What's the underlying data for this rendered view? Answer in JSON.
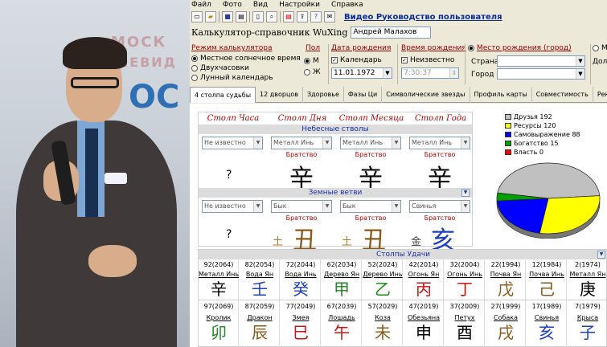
{
  "photo": {
    "banner_line1": "МОСК",
    "banner_line2": "ТЕЛЕВИД",
    "banner_line3": "ОС"
  },
  "menu": [
    "Файл",
    "Фото",
    "Вид",
    "Настройки",
    "Справка"
  ],
  "toolbar": {
    "icons": [
      "new-file-icon",
      "open-folder-icon",
      "save-icon",
      "print-icon",
      "document-icon",
      "search-icon",
      "pdf-icon",
      "export-icon",
      "help-icon",
      "mail-icon"
    ],
    "help_link": "Видео Руководство пользователя"
  },
  "app_title": "Калькулятор-справочник WuXing",
  "person_name": "Андрей Малахов",
  "mode": {
    "title": "Режим калькулятора",
    "options": [
      "Местное солнечное время",
      "Двухчасовки",
      "Лунный календарь"
    ],
    "selected_index": 0
  },
  "gender": {
    "title": "Пол",
    "options": [
      "М",
      "Ж"
    ],
    "selected_index": 0
  },
  "birth_date": {
    "title": "Дата рождения",
    "calendar_label": "Календарь",
    "value": "11.01.1972"
  },
  "birth_time": {
    "title": "Время рождения",
    "unknown_label": "Неизвестно",
    "value": "7:30:37"
  },
  "birth_place": {
    "title": "Место рождения (город)",
    "country_label": "Страна",
    "city_label": "Город",
    "extra_m": "М",
    "extra_dol": "Дол"
  },
  "tabs": [
    "4 столпа судьбы",
    "12 дворцов",
    "Здоровье",
    "Фазы Ци",
    "Символические звезды",
    "Профиль карты",
    "Совместимость",
    "Ректификация"
  ],
  "active_tab": 0,
  "pillars": {
    "headers": [
      "Столп Часа",
      "Столп Дня",
      "Столп Месяца",
      "Столп Года"
    ],
    "stems_band": "Небесные стволы",
    "branches_band": "Земные ветви",
    "stem_selects": [
      "Не известно",
      "Металл Инь",
      "Металл Инь",
      "Металл Инь"
    ],
    "stem_relations": [
      "",
      "Братство",
      "Братство",
      "Братство"
    ],
    "stem_glyphs": [
      "?",
      "辛",
      "辛",
      "辛"
    ],
    "branch_selects": [
      "Не известно",
      "Бык",
      "Бык",
      "Свинья"
    ],
    "branch_relations": [
      "",
      "Братство",
      "Братство",
      "Братство"
    ],
    "branch_glyphs": [
      "?",
      "丑",
      "丑",
      "亥"
    ],
    "branch_glyph_colors": [
      "#000000",
      "#8b5a1b",
      "#8b5a1b",
      "#1c3fc0"
    ],
    "hidden_glyphs": [
      "",
      "土",
      "土",
      "金"
    ],
    "hidden_colors": [
      "#000000",
      "#b07a30",
      "#b07a30",
      "#444444"
    ]
  },
  "chart_data": {
    "type": "pie",
    "categories": [
      "Друзья",
      "Ресурсы",
      "Самовыражение",
      "Богатство",
      "Власть"
    ],
    "values": [
      192,
      120,
      88,
      15,
      0
    ],
    "colors": [
      "#c0c0c0",
      "#ffff00",
      "#0000ff",
      "#00a000",
      "#ff0000"
    ]
  },
  "luck": {
    "band": "Столпы Удачи",
    "columns": [
      {
        "age": "92(2064)",
        "el1": "Металл Инь",
        "g1": "辛",
        "c1": "#000000",
        "age2": "97(2069)",
        "an": "Кролик",
        "g2": "卯",
        "c2": "#1f8a1f"
      },
      {
        "age": "82(2054)",
        "el1": "Вода Ян",
        "g1": "壬",
        "c1": "#1c3fc0",
        "age2": "87(2059)",
        "an": "Дракон",
        "g2": "辰",
        "c2": "#8b5a1b"
      },
      {
        "age": "72(2044)",
        "el1": "Вода Инь",
        "g1": "癸",
        "c1": "#1c3fc0",
        "age2": "77(2049)",
        "an": "Змея",
        "g2": "巳",
        "c2": "#d01010"
      },
      {
        "age": "62(2034)",
        "el1": "Дерево Ян",
        "g1": "甲",
        "c1": "#1f8a1f",
        "age2": "67(2039)",
        "an": "Лошадь",
        "g2": "午",
        "c2": "#d01010"
      },
      {
        "age": "52(2024)",
        "el1": "Дерево Инь",
        "g1": "乙",
        "c1": "#1f8a1f",
        "age2": "57(2029)",
        "an": "Коза",
        "g2": "未",
        "c2": "#8b5a1b"
      },
      {
        "age": "42(2014)",
        "el1": "Огонь Ян",
        "g1": "丙",
        "c1": "#d01010",
        "age2": "47(2019)",
        "an": "Обезьяна",
        "g2": "申",
        "c2": "#000000"
      },
      {
        "age": "32(2004)",
        "el1": "Огонь Инь",
        "g1": "丁",
        "c1": "#d01010",
        "age2": "37(2009)",
        "an": "Петух",
        "g2": "酉",
        "c2": "#000000"
      },
      {
        "age": "22(1994)",
        "el1": "Почва Ян",
        "g1": "戊",
        "c1": "#8b5a1b",
        "age2": "27(1999)",
        "an": "Собака",
        "g2": "戌",
        "c2": "#8b5a1b"
      },
      {
        "age": "12(1984)",
        "el1": "Почва Инь",
        "g1": "己",
        "c1": "#8b5a1b",
        "age2": "17(1989)",
        "an": "Свинья",
        "g2": "亥",
        "c2": "#1c3fc0"
      },
      {
        "age": "2(1974)",
        "el1": "Металл Ян",
        "g1": "庚",
        "c1": "#000000",
        "age2": "7(1979)",
        "an": "Крыса",
        "g2": "子",
        "c2": "#1c3fc0"
      }
    ]
  }
}
